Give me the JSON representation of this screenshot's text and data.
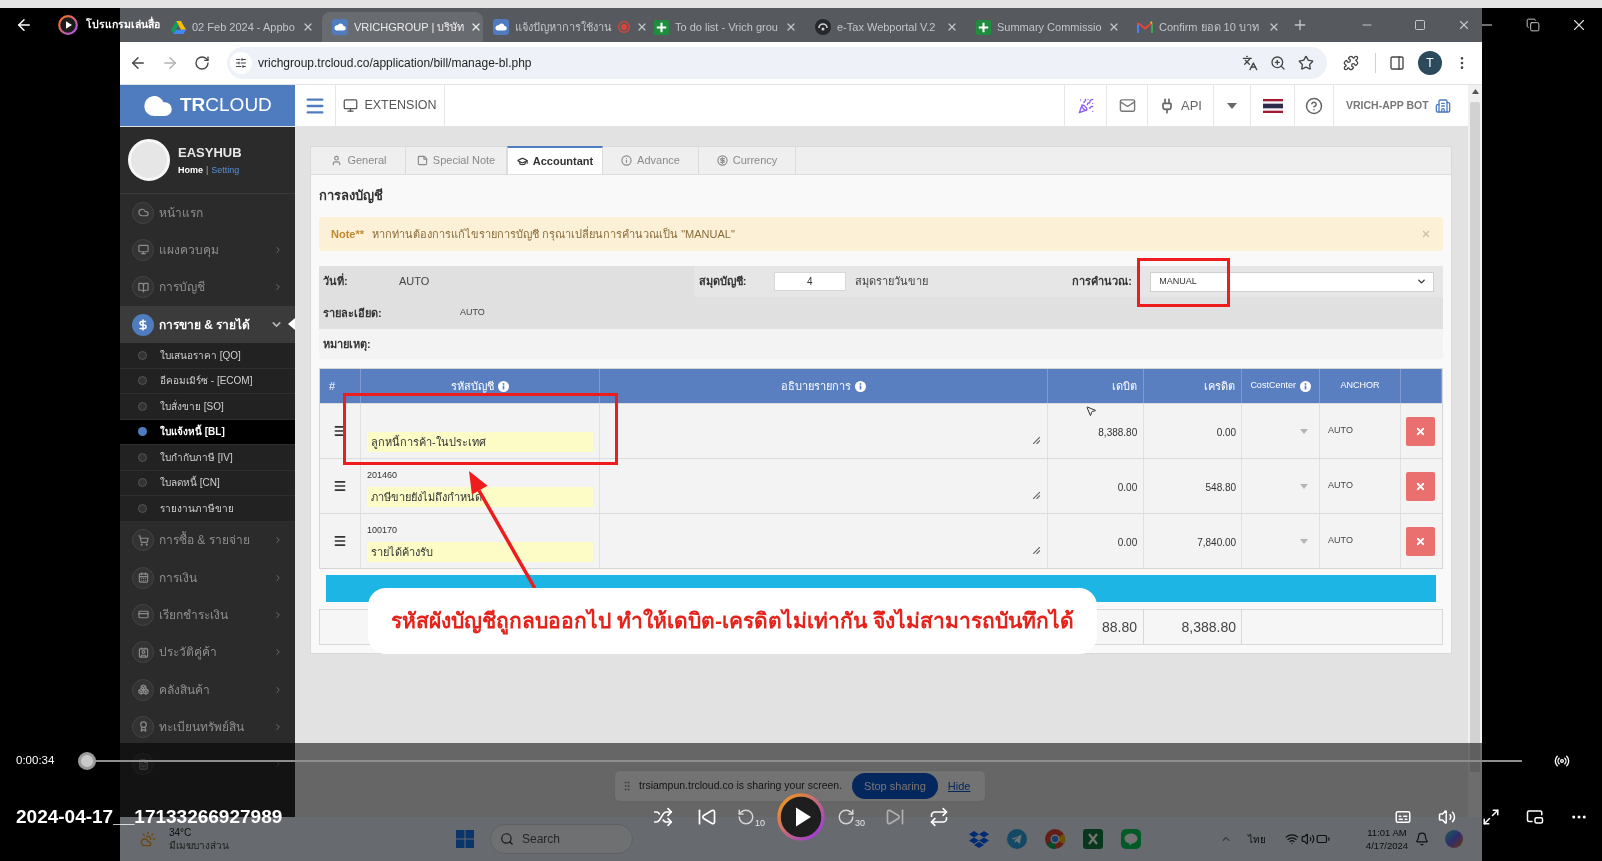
{
  "player": {
    "title": "โปรแกรมเล่นสื่อ",
    "time": "0:00:34",
    "progress": {
      "level": 0
    },
    "filename": "2024-04-17__17133266927989",
    "playing": false,
    "rewind_label": "10",
    "forward_label": "30"
  },
  "browser": {
    "tabs": [
      {
        "kind": "drive",
        "title": "02 Feb 2024 - Appbo",
        "selected": false,
        "recording": false
      },
      {
        "kind": "cloud",
        "title": "VRICHGROUP | บริษัท",
        "selected": true,
        "recording": false
      },
      {
        "kind": "cloud",
        "title": "แจ้งปัญหาการใช้งาน",
        "selected": false,
        "recording": true
      },
      {
        "kind": "sheets",
        "title": "To do list - Vrich grou",
        "selected": false,
        "recording": false
      },
      {
        "kind": "etax",
        "title": "e-Tax Webportal V.2",
        "selected": false,
        "recording": false
      },
      {
        "kind": "sheets",
        "title": "Summary Commissio",
        "selected": false,
        "recording": false
      },
      {
        "kind": "gmail",
        "title": "Confirm ยอด 10 บาท",
        "selected": false,
        "recording": false
      }
    ],
    "url": "vrichgroup.trcloud.co/application/bill/manage-bl.php",
    "profile_initial": "T"
  },
  "app": {
    "logo": "**TR**CLOUD",
    "header": {
      "extension": "EXTENSION",
      "api": "API",
      "account": "VRICH-APP BOT"
    },
    "profile": {
      "name": "EASYHUB",
      "home": "Home",
      "separator": "|",
      "setting": "Setting"
    },
    "sidebar": [
      {
        "kind": "home",
        "label": "หน้าแรก",
        "selected": false
      },
      {
        "kind": "dashboard",
        "label": "แผงควบคุม",
        "expanded": false,
        "selected": false
      },
      {
        "kind": "accounting",
        "label": "การบัญชี",
        "expanded": false,
        "selected": false
      },
      {
        "kind": "sales",
        "label": "การขาย & รายได้",
        "expanded": true,
        "selected": true,
        "children": [
          {
            "label": "ใบเสนอราคา [QO]",
            "selected": false
          },
          {
            "label": "อีคอมเมิร์ซ - [ECOM]",
            "selected": false
          },
          {
            "label": "ใบสั่งขาย [SO]",
            "selected": false
          },
          {
            "label": "ใบแจ้งหนี้ [BL]",
            "selected": true
          },
          {
            "label": "ใบกำกับภาษี [IV]",
            "selected": false
          },
          {
            "label": "ใบลดหนี้ [CN]",
            "selected": false
          },
          {
            "label": "รายงานภาษีขาย",
            "selected": false
          }
        ]
      },
      {
        "kind": "purchase",
        "label": "การซื้อ & รายจ่าย",
        "expanded": false,
        "selected": false
      },
      {
        "kind": "finance",
        "label": "การเงิน",
        "expanded": false,
        "selected": false
      },
      {
        "kind": "billing",
        "label": "เรียกชำระเงิน",
        "expanded": false,
        "selected": false
      },
      {
        "kind": "contacts",
        "label": "ประวัติคู่ค้า",
        "expanded": false,
        "selected": false
      },
      {
        "kind": "inventory",
        "label": "คลังสินค้า",
        "expanded": false,
        "selected": false
      },
      {
        "kind": "assets",
        "label": "ทะเบียนทรัพย์สิน",
        "expanded": false,
        "selected": false
      },
      {
        "kind": "reports",
        "expanded": false,
        "selected": false
      }
    ],
    "tabs": [
      {
        "kind": "user",
        "label": "General",
        "selected": false
      },
      {
        "kind": "note",
        "label": "Special Note",
        "selected": false
      },
      {
        "kind": "cap",
        "label": "Accountant",
        "selected": true
      },
      {
        "kind": "info",
        "label": "Advance",
        "selected": false
      },
      {
        "kind": "coin",
        "label": "Currency",
        "selected": false
      }
    ],
    "section_title": "การลงบัญชี",
    "note": {
      "label": "Note**",
      "message": "หากท่านต้องการแก้ไขรายการบัญชี กรุณาเปลี่ยนการคำนวณเป็น \"MANUAL\""
    },
    "form": {
      "date_label": "วันที่:",
      "date_value": "AUTO",
      "book_label": "สมุดบัญชี:",
      "book_number": "4",
      "book_name": "สมุดรายวันขาย",
      "calc_label": "การคำนวณ:",
      "calc_value": "MANUAL",
      "detail_label": "รายละเอียด:",
      "detail_value": "AUTO",
      "remark_label": "หมายเหตุ:"
    },
    "table": {
      "columns": [
        {
          "label": "#",
          "info": false
        },
        {
          "label": "รหัสบัญชี",
          "info": true
        },
        {
          "label": "อธิบายรายการ",
          "info": true
        },
        {
          "label": "เดบิต",
          "info": false
        },
        {
          "label": "เครดิต",
          "info": false
        },
        {
          "label": "CostCenter",
          "info": true
        },
        {
          "label": "ANCHOR",
          "info": false
        }
      ],
      "rows": [
        {
          "name": "ลูกหนี้การค้า-ในประเทศ",
          "debit": "8,388.80",
          "credit": "0.00",
          "anchor": "AUTO"
        },
        {
          "code": "201460",
          "name": "ภาษีขายยังไม่ถึงกำหนด",
          "debit": "0.00",
          "credit": "548.80",
          "anchor": "AUTO"
        },
        {
          "code": "100170",
          "name": "รายได้ค้างรับ",
          "debit": "0.00",
          "credit": "7,840.00",
          "anchor": "AUTO"
        }
      ],
      "totals": {
        "debit": "88.80",
        "credit": "8,388.80"
      }
    }
  },
  "annotation": {
    "message": "รหัสผังบัญชีถูกลบออกไป ทำให้เดบิต-เครดิตไม่เท่ากัน จึงไม่สามารถบันทึกได้"
  },
  "screen_share": {
    "message": "trsiampun.trcloud.co is sharing your screen.",
    "stop": "Stop sharing",
    "hide": "Hide"
  },
  "taskbar": {
    "temperature": "34°C",
    "weather": "มีเมฆบางส่วน",
    "search": {
      "placeholder": "Search"
    },
    "language": "ไทย",
    "time": "11:01 AM",
    "date": "4/17/2024"
  }
}
